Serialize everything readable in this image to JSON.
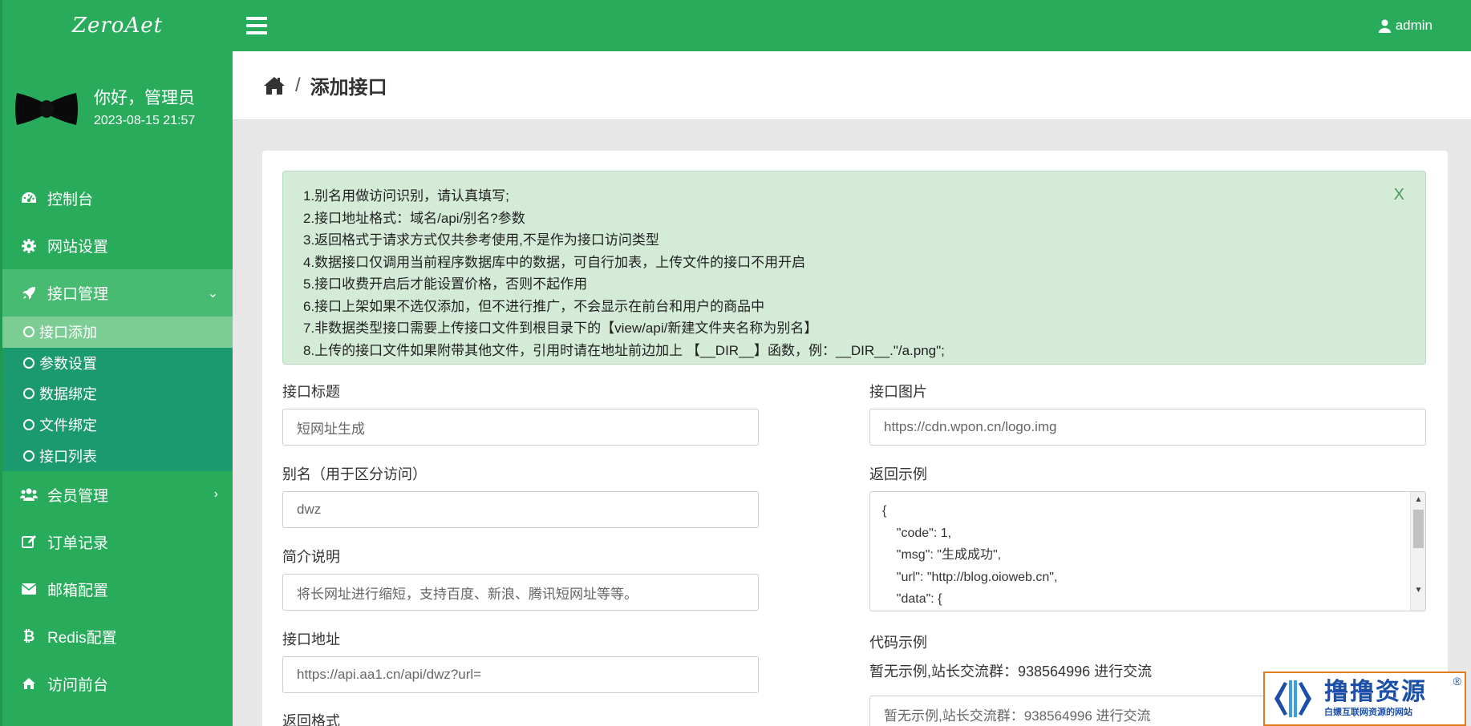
{
  "brand": {
    "logo_text": "ZeroAet"
  },
  "topbar": {
    "username": "admin"
  },
  "profile": {
    "greeting": "你好，管理员",
    "datetime": "2023-08-15 21:57"
  },
  "sidebar": {
    "items": [
      {
        "label": "控制台",
        "icon": "dashboard-icon"
      },
      {
        "label": "网站设置",
        "icon": "gear-icon"
      },
      {
        "label": "接口管理",
        "icon": "rocket-icon"
      },
      {
        "label": "会员管理",
        "icon": "users-icon"
      },
      {
        "label": "订单记录",
        "icon": "edit-icon"
      },
      {
        "label": "邮箱配置",
        "icon": "envelope-icon"
      },
      {
        "label": "Redis配置",
        "icon": "bitcoin-icon"
      },
      {
        "label": "访问前台",
        "icon": "home-icon"
      }
    ],
    "subitems": [
      "接口添加",
      "参数设置",
      "数据绑定",
      "文件绑定",
      "接口列表"
    ]
  },
  "breadcrumb": {
    "separator": "/",
    "title": "添加接口"
  },
  "alert": {
    "close": "X",
    "lines": [
      "1.别名用做访问识别，请认真填写;",
      "2.接口地址格式：域名/api/别名?参数",
      "3.返回格式于请求方式仅共参考使用,不是作为接口访问类型",
      "4.数据接口仅调用当前程序数据库中的数据，可自行加表，上传文件的接口不用开启",
      "5.接口收费开启后才能设置价格，否则不起作用",
      "6.接口上架如果不选仅添加，但不进行推广，不会显示在前台和用户的商品中",
      "7.非数据类型接口需要上传接口文件到根目录下的【view/api/新建文件夹名称为别名】",
      "8.上传的接口文件如果附带其他文件，引用时请在地址前边加上 【__DIR__】函数，例：__DIR__.\"/a.png\";"
    ]
  },
  "form": {
    "title_label": "接口标题",
    "title_value": "短网址生成",
    "image_label": "接口图片",
    "image_value": "https://cdn.wpon.cn/logo.img",
    "alias_label": "别名（用于区分访问）",
    "alias_value": "dwz",
    "return_example_label": "返回示例",
    "return_example_lines": [
      "{",
      "    \"code\": 1,",
      "    \"msg\": \"生成成功\",",
      "    \"url\": \"http://blog.oioweb.cn\",",
      "    \"data\": {"
    ],
    "desc_label": "简介说明",
    "desc_value": "将长网址进行缩短，支持百度、新浪、腾讯短网址等等。",
    "url_label": "接口地址",
    "url_value": "https://api.aa1.cn/api/dwz?url=",
    "code_example_label": "代码示例",
    "code_example_text": "暂无示例,站长交流群：938564996 进行交流",
    "code_example_value": "暂无示例,站长交流群：938564996 进行交流",
    "return_format_label": "返回格式"
  },
  "watermark": {
    "title": "撸撸资源",
    "subtitle": "白嫖互联网资源的网站",
    "reg": "®"
  },
  "colors": {
    "primary": "#28ac5c",
    "alert_bg": "#d4ebd8",
    "submenu_bg": "#1a9a6e",
    "active_sub": "#7ccd94"
  }
}
